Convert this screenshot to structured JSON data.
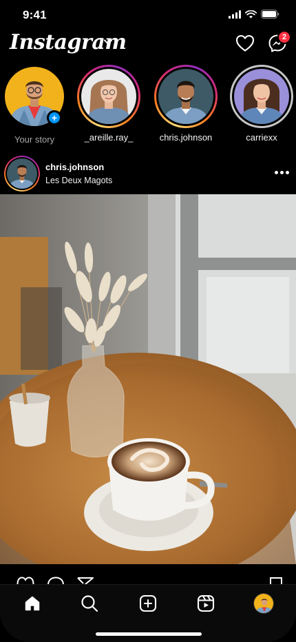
{
  "status_bar": {
    "time": "9:41"
  },
  "header": {
    "logo": "Instagram",
    "notifications_badge": "2"
  },
  "stories": [
    {
      "name": "Your story",
      "type": "own"
    },
    {
      "name": "_areille.ray_",
      "type": "unseen"
    },
    {
      "name": "chris.johnson",
      "type": "unseen"
    },
    {
      "name": "carriexx",
      "type": "seen"
    }
  ],
  "post": {
    "username": "chris.johnson",
    "location": "Les Deux Magots"
  },
  "bottom_nav": [
    "home-icon",
    "search-icon",
    "create-icon",
    "reels-icon",
    "profile-avatar"
  ],
  "colors": {
    "accent": "#0095f6",
    "badge": "#ff3040",
    "background": "#000000"
  }
}
